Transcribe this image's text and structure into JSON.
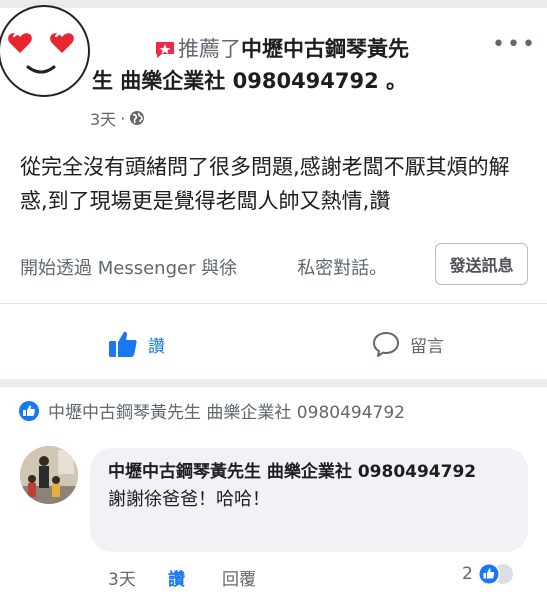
{
  "post": {
    "recommend_verb": "推薦了",
    "page_name_line1": "中壢中古鋼琴黃先",
    "page_name_line2": "生 曲樂企業社 0980494792 。",
    "time": "3天",
    "more": "•••",
    "text": "從完全沒有頭緒問了很多問題,感謝老闆不厭其煩的解惑,到了現場更是覺得老闆人帥又熱情,讚",
    "messenger_prefix": "開始透過 Messenger 與徐",
    "messenger_suffix": "私密對話。",
    "send_button": "發送訊息",
    "like_label": "讚",
    "comment_label": "留言"
  },
  "reply_thread": {
    "reacted_by": "中壢中古鋼琴黃先生 曲樂企業社 0980494792",
    "comment": {
      "author": "中壢中古鋼琴黃先生 曲樂企業社 0980494792",
      "text": "謝謝徐爸爸！哈哈！",
      "time": "3天",
      "like": "讚",
      "reply": "回覆",
      "reaction_count": "2"
    }
  },
  "colors": {
    "accent": "#1877f2",
    "recommend_badge": "#f02849",
    "divider": "#dddfe2",
    "band": "#e9ebee"
  }
}
